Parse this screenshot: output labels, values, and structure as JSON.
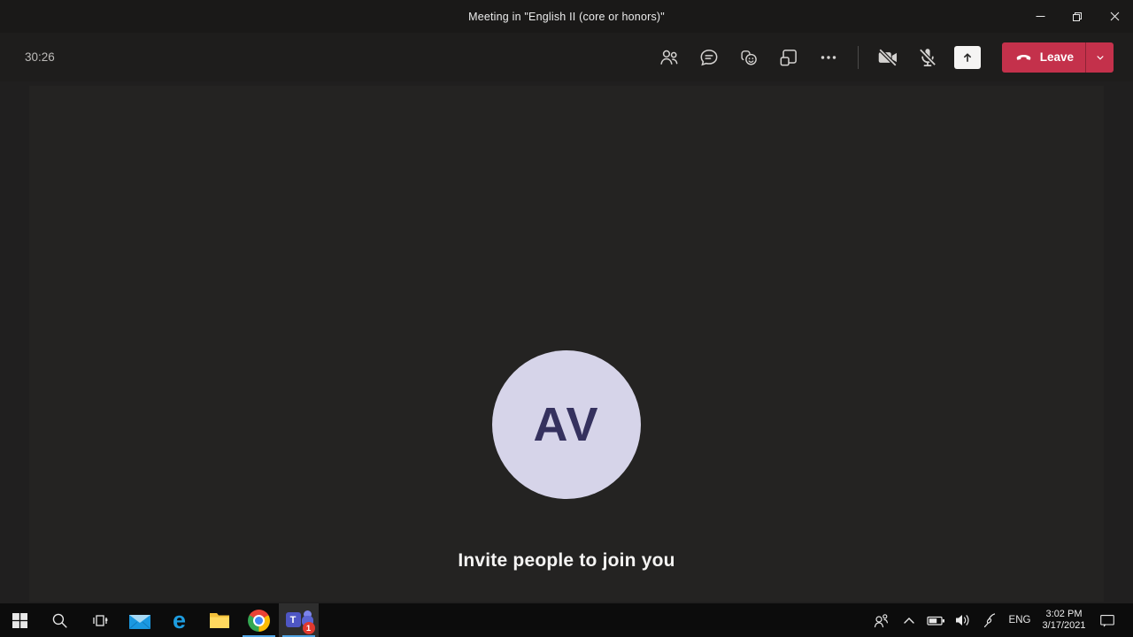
{
  "window": {
    "title": "Meeting in \"English II (core or honors)\""
  },
  "meeting_toolbar": {
    "timer": "30:26",
    "leave_label": "Leave",
    "icons": [
      "participants",
      "chat",
      "reactions",
      "breakout-rooms",
      "more-actions",
      "camera-off",
      "microphone-off",
      "share-content",
      "leave-call",
      "leave-options"
    ]
  },
  "stage": {
    "avatar_initials": "AV",
    "invite_text": "Invite people to join you"
  },
  "taskbar": {
    "icons": [
      "start",
      "search",
      "task-view",
      "mail",
      "edge",
      "file-explorer",
      "chrome",
      "teams"
    ],
    "teams_badge": "1",
    "tray_icons": [
      "people",
      "hidden-icons-chevron",
      "battery",
      "volume",
      "windows-ink-pen",
      "action-center"
    ],
    "language": "ENG",
    "time": "3:02 PM",
    "date": "3/17/2021"
  },
  "colors": {
    "titlebar-bg": "#1a1918",
    "toolbar-bg": "#1e1d1c",
    "stage-bg": "#201f1f",
    "taskbar-bg": "#0c0c0c",
    "accent-red": "#C4314B",
    "avatar-bg": "#D6D4E9",
    "avatar-fg": "#35315E",
    "icon-gray": "#D4D2D0",
    "underline-blue": "#4FA3E3"
  }
}
